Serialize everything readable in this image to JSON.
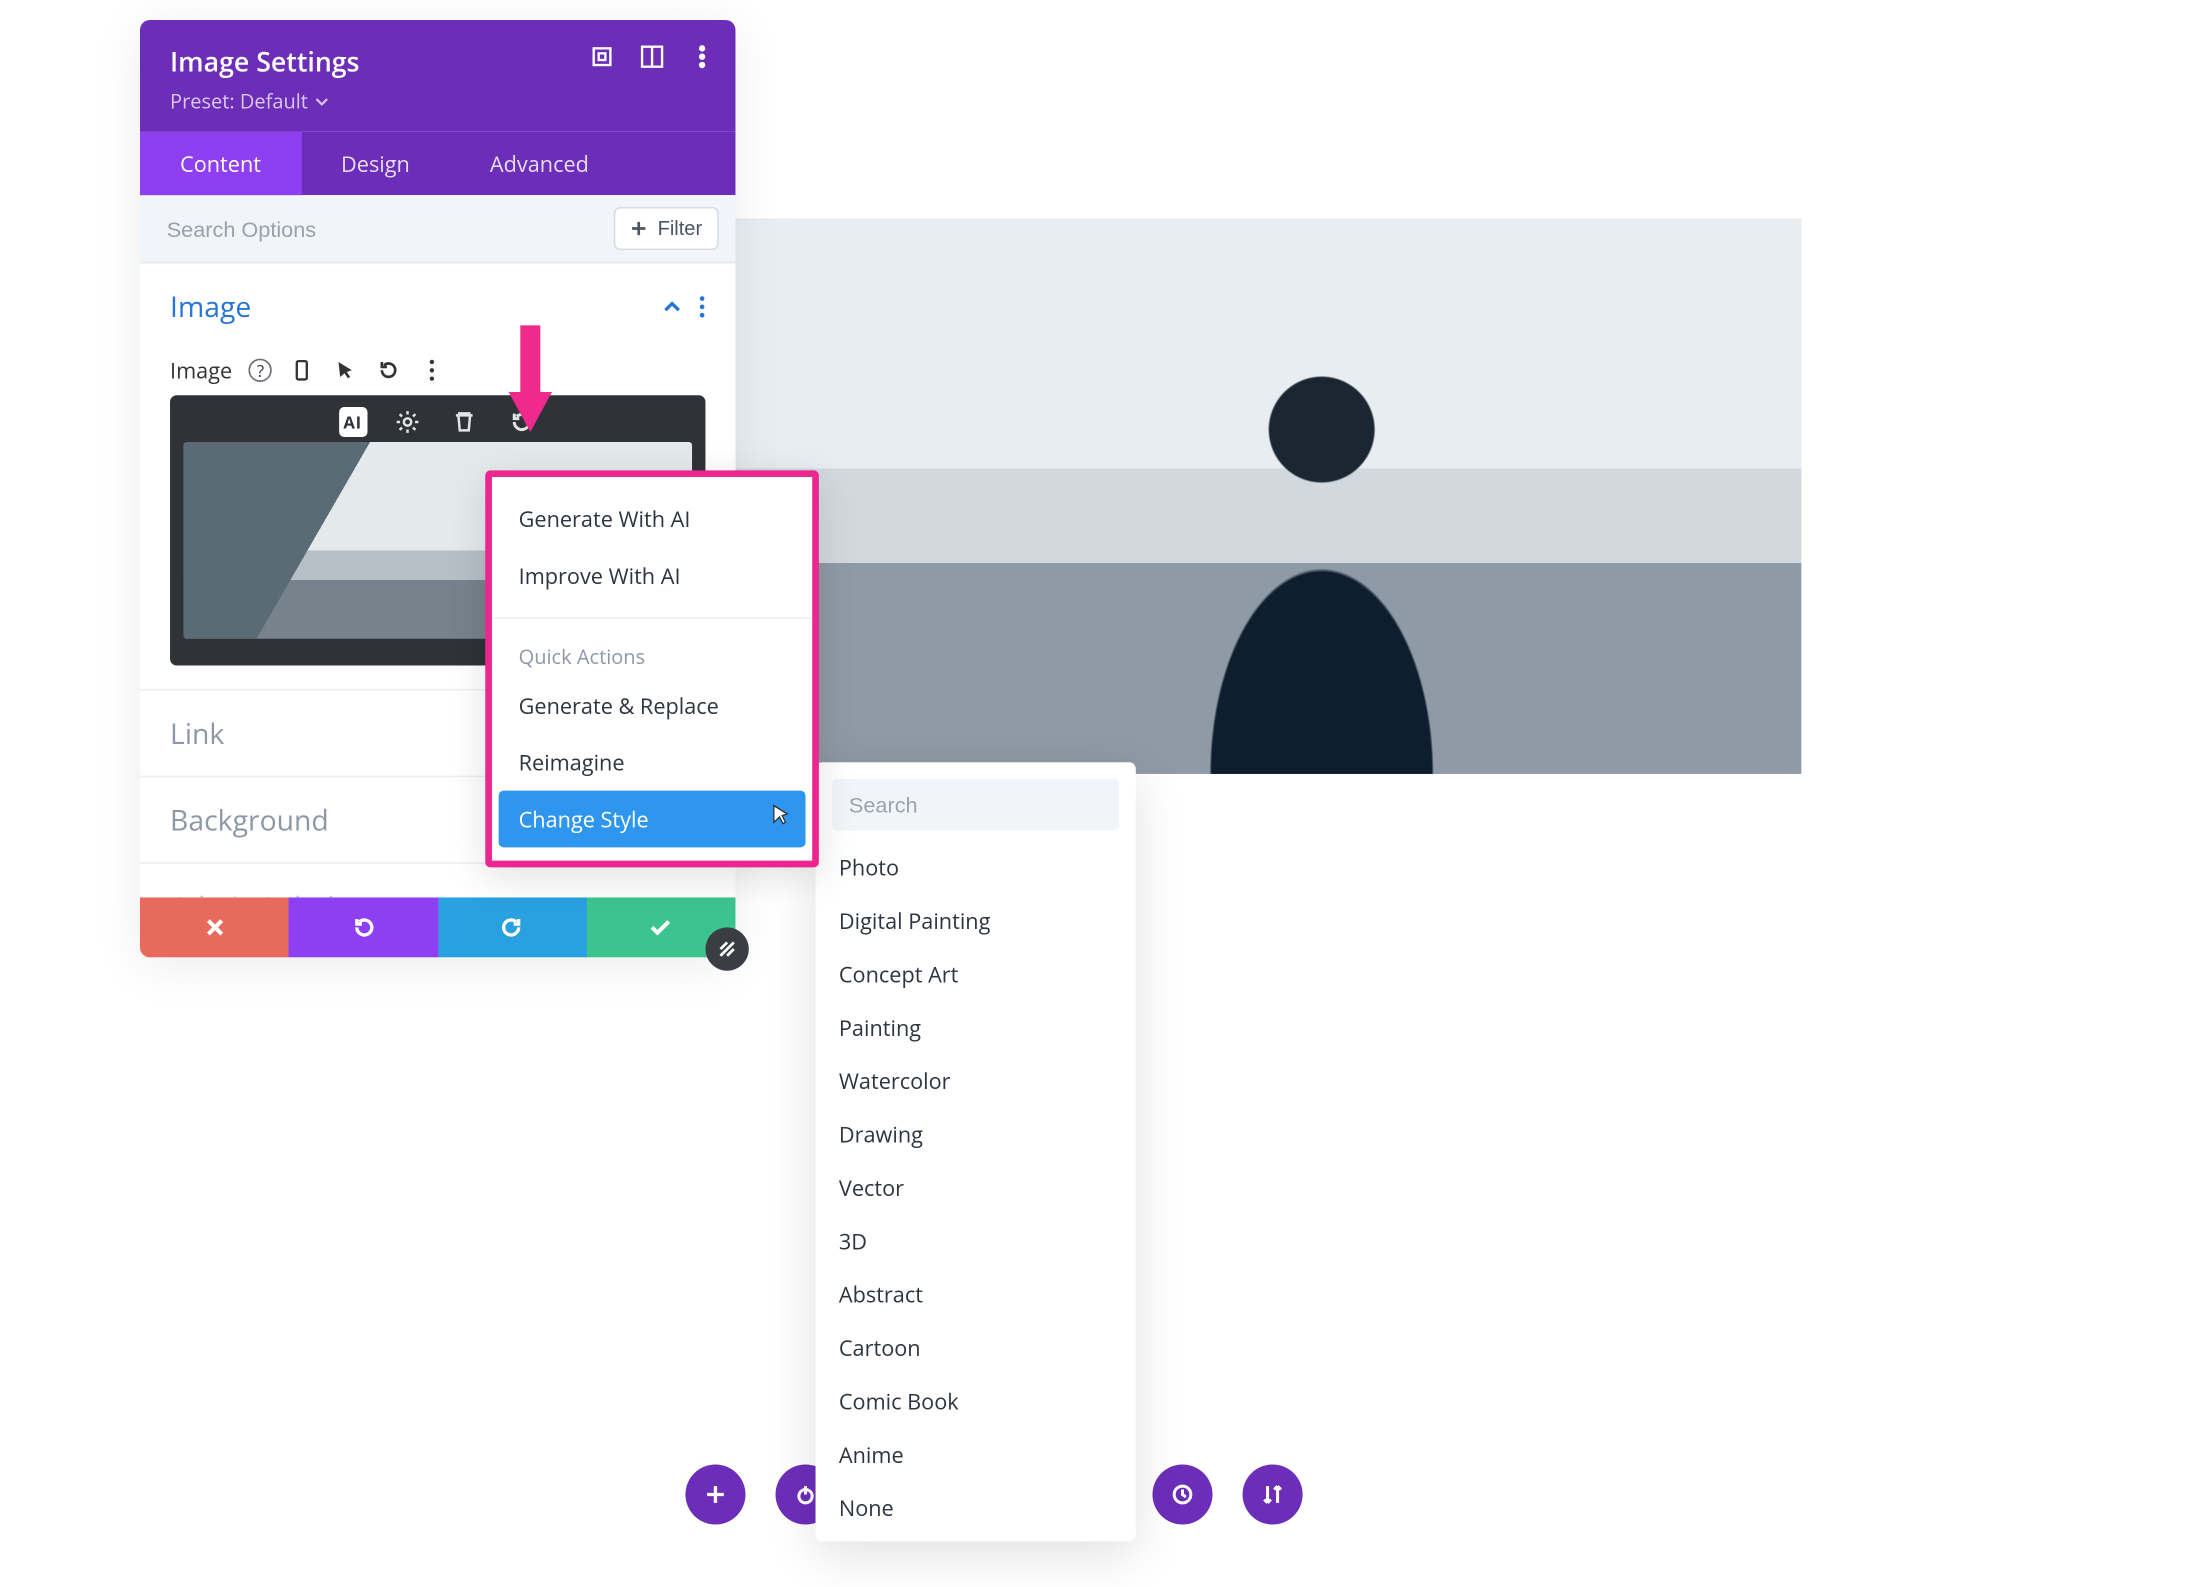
{
  "panel": {
    "title": "Image Settings",
    "preset_label": "Preset: Default",
    "tabs": {
      "content": "Content",
      "design": "Design",
      "advanced": "Advanced"
    },
    "search_placeholder": "Search Options",
    "filter_label": "Filter",
    "sections": {
      "image": {
        "title": "Image",
        "field_label": "Image"
      },
      "link": {
        "title": "Link"
      },
      "background": {
        "title": "Background"
      },
      "admin_label": {
        "title": "Admin Label"
      }
    }
  },
  "ai_menu": {
    "group1": [
      "Generate With AI",
      "Improve With AI"
    ],
    "caption": "Quick Actions",
    "group2": [
      "Generate & Replace",
      "Reimagine",
      "Change Style"
    ],
    "selected": "Change Style"
  },
  "style_dd": {
    "search_placeholder": "Search",
    "options": [
      "Photo",
      "Digital Painting",
      "Concept Art",
      "Painting",
      "Watercolor",
      "Drawing",
      "Vector",
      "3D",
      "Abstract",
      "Cartoon",
      "Comic Book",
      "Anime",
      "None"
    ]
  }
}
